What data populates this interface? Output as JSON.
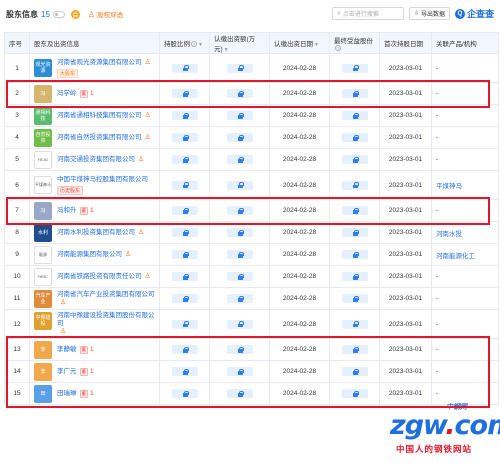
{
  "toolbar": {
    "title": "股东信息",
    "count": "15",
    "vip_label": "会",
    "relation_label": "股权穿透",
    "search_placeholder": "点击进行搜索",
    "export_label": "导出数据",
    "brand": "企查查",
    "brand_logo": "Q"
  },
  "table": {
    "headers": [
      "序号",
      "股东及出资信息",
      "持股比例",
      "认缴出资额(万元)",
      "认缴出资日期",
      "最终受益股份",
      "首次持股日期",
      "关联产品/机构"
    ],
    "rows": [
      {
        "idx": "1",
        "name": "河南省观光资源集团有限公司",
        "logo_text": "观光资源",
        "logo_color": "#2c8dd6",
        "person_icon": true,
        "tag": "大股东",
        "tag_color": "orange",
        "date": "2024-02-28",
        "first_date": "2023-03-01",
        "related": "-"
      },
      {
        "idx": "2",
        "name": "冯学岭",
        "logo_text": "冯",
        "logo_color": "#d6b56f",
        "person_tag": "1",
        "date": "2024-02-28",
        "first_date": "2023-03-01",
        "related": "-"
      },
      {
        "idx": "3",
        "name": "河南省通相科技集团有限公司",
        "logo_text": "通相科技",
        "logo_color": "#5bbd6c",
        "person_icon": true,
        "date": "2024-02-28",
        "first_date": "2023-03-01",
        "related": "-"
      },
      {
        "idx": "4",
        "name": "河南省自然投资集团有限公司",
        "logo_text": "自然投资",
        "logo_color": "#6fbe4a",
        "person_icon": true,
        "date": "2024-02-28",
        "first_date": "2023-03-01",
        "related": "-"
      },
      {
        "idx": "5",
        "name": "河南交通投资集团有限公司",
        "logo_text": "HCIG",
        "logo_bordered": true,
        "person_icon": true,
        "date": "2024-02-28",
        "first_date": "2023-03-01",
        "related": "-"
      },
      {
        "idx": "6",
        "name": "中国平煤神马控股集团有限公司",
        "logo_text": "平煤神马",
        "logo_bordered": true,
        "tag": "历史股东",
        "tag_color": "red",
        "date": "2024-02-28",
        "first_date": "2023-03-01",
        "related": "平煤神马"
      },
      {
        "idx": "7",
        "name": "冯和升",
        "logo_text": "冯",
        "logo_color": "#9aa8c8",
        "person_tag": "1",
        "date": "2024-02-28",
        "first_date": "2023-03-01",
        "related": "-"
      },
      {
        "idx": "8",
        "name": "河南水利投资集团有限公司",
        "logo_text": "水利",
        "logo_color": "#1f4e8f",
        "person_icon": true,
        "date": "2024-02-28",
        "first_date": "2023-03-01",
        "related": "河南水投"
      },
      {
        "idx": "9",
        "name": "河南能源集团有限公司",
        "logo_text": "能源",
        "logo_bordered": true,
        "person_icon": true,
        "date": "2024-02-28",
        "first_date": "2023-03-01",
        "related": "河南能源化工"
      },
      {
        "idx": "10",
        "name": "河南省铁路投资有限责任公司",
        "logo_text": "HRIC",
        "logo_bordered": true,
        "person_icon": true,
        "date": "2024-02-28",
        "first_date": "2023-03-01",
        "related": "-"
      },
      {
        "idx": "11",
        "name": "河南省汽车产业投资集团有限公司",
        "logo_text": "汽车产业",
        "logo_color": "#e08a3c",
        "person_icon": true,
        "date": "2024-02-28",
        "first_date": "2023-03-01",
        "related": "-"
      },
      {
        "idx": "12",
        "name": "河南中豫建设投资集团股份有限公司",
        "logo_text": "中豫建投",
        "logo_color": "#e0a030",
        "person_icon": true,
        "date": "2024-02-28",
        "first_date": "2023-03-01",
        "related": "-"
      },
      {
        "idx": "13",
        "name": "李静敏",
        "logo_text": "李",
        "logo_color": "#f0a84a",
        "person_tag": "1",
        "date": "2024-02-28",
        "first_date": "2023-03-01",
        "related": "-"
      },
      {
        "idx": "14",
        "name": "李广元",
        "logo_text": "李",
        "logo_color": "#f0a84a",
        "person_tag": "1",
        "date": "2024-02-28",
        "first_date": "2023-03-01",
        "related": "-"
      },
      {
        "idx": "15",
        "name": "田瑞琳",
        "logo_text": "田",
        "logo_color": "#5aa0e6",
        "person_tag": "1",
        "date": "2024-02-28",
        "first_date": "2023-03-01",
        "related": "-"
      }
    ],
    "person_mark": "董"
  },
  "watermark": {
    "top": "中钢网",
    "big_a": "zgw",
    "big_dot": ".",
    "big_b": "com",
    "sub": "中国人的钢铁网站"
  }
}
